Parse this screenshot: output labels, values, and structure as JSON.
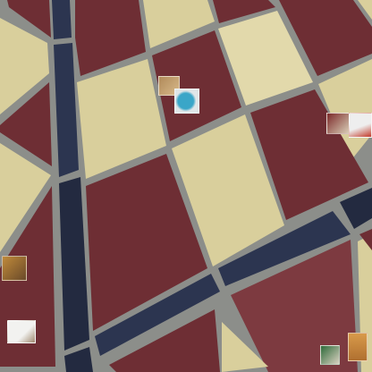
{
  "scene": {
    "description_kind": "photo",
    "colors": {
      "grout": "#8c8e8a",
      "maroon_tile": "#6e2e34",
      "maroon_tile_light": "#7d3a40",
      "cream_tile": "#d9cf9c",
      "cream_tile_light": "#e2d9ab",
      "navy_band": "#2c3550",
      "navy_band_dark": "#232a40"
    }
  },
  "stickers": [
    {
      "name": "sticker-hand",
      "colors": [
        "#b08a5a",
        "#d8b98a"
      ]
    },
    {
      "name": "sticker-blue-cloth",
      "colors": [
        "#3aa6c8",
        "#e0e6e8"
      ]
    },
    {
      "name": "sticker-red-object",
      "colors": [
        "#7b2a2a",
        "#d9cdb6"
      ]
    },
    {
      "name": "sticker-white-figure",
      "colors": [
        "#eeeeee",
        "#c23a2a"
      ]
    },
    {
      "name": "sticker-food",
      "colors": [
        "#c08a3a",
        "#6a4a2a"
      ]
    },
    {
      "name": "sticker-paper",
      "colors": [
        "#f2f2f0",
        "#a08a70"
      ]
    },
    {
      "name": "sticker-green-item",
      "colors": [
        "#2f6a3a",
        "#d8d0c0"
      ]
    },
    {
      "name": "sticker-orange-item",
      "colors": [
        "#d89a4a",
        "#b07030"
      ]
    }
  ]
}
